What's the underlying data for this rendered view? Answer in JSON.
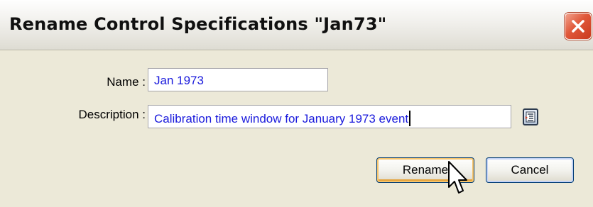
{
  "window": {
    "title": "Rename Control Specifications \"Jan73\"",
    "close_icon": "close-x-icon"
  },
  "form": {
    "name_label": "Name :",
    "name_value": "Jan 1973",
    "description_label": "Description :",
    "description_value": "Calibration time window for January 1973 event",
    "description_picker_icon": "text-editor-icon"
  },
  "buttons": {
    "rename_label": "Rename",
    "cancel_label": "Cancel"
  },
  "colors": {
    "accent_close": "#e0583a",
    "input_text": "#1a1adc",
    "default_button_glow": "#f6c46c"
  }
}
